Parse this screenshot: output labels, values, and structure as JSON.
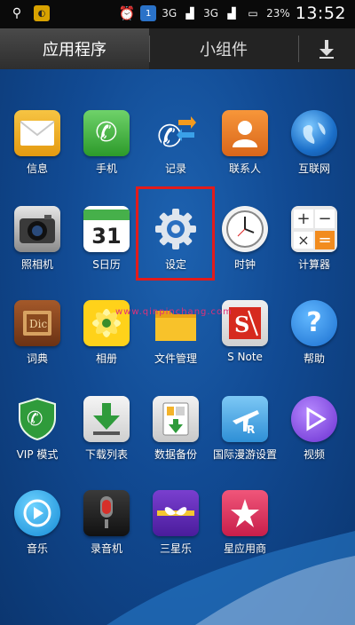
{
  "status_bar": {
    "time": "13:52",
    "battery": "23%",
    "network_1": "3G",
    "network_2": "3G",
    "sim": "1"
  },
  "tabs": {
    "apps": "应用程序",
    "widgets": "小组件"
  },
  "apps": [
    {
      "label": "信息",
      "icon": "envelope-icon"
    },
    {
      "label": "手机",
      "icon": "phone-icon"
    },
    {
      "label": "记录",
      "icon": "call-log-icon"
    },
    {
      "label": "联系人",
      "icon": "contacts-icon"
    },
    {
      "label": "互联网",
      "icon": "globe-icon"
    },
    {
      "label": "照相机",
      "icon": "camera-icon"
    },
    {
      "label": "S日历",
      "icon": "calendar-icon",
      "day": "31"
    },
    {
      "label": "设定",
      "icon": "gear-icon"
    },
    {
      "label": "时钟",
      "icon": "clock-icon"
    },
    {
      "label": "计算器",
      "icon": "calculator-icon"
    },
    {
      "label": "词典",
      "icon": "dictionary-icon"
    },
    {
      "label": "相册",
      "icon": "gallery-icon"
    },
    {
      "label": "文件管理",
      "icon": "folder-icon"
    },
    {
      "label": "S Note",
      "icon": "snote-icon"
    },
    {
      "label": "帮助",
      "icon": "help-icon"
    },
    {
      "label": "VIP 模式",
      "icon": "vip-shield-icon"
    },
    {
      "label": "下载列表",
      "icon": "download-list-icon"
    },
    {
      "label": "数据备份",
      "icon": "backup-icon"
    },
    {
      "label": "国际漫游设置",
      "icon": "roaming-icon"
    },
    {
      "label": "视频",
      "icon": "video-icon"
    },
    {
      "label": "音乐",
      "icon": "music-icon"
    },
    {
      "label": "录音机",
      "icon": "recorder-icon"
    },
    {
      "label": "三星乐",
      "icon": "samsung-hub-icon"
    },
    {
      "label": "星应用商",
      "icon": "app-store-icon"
    }
  ],
  "watermark": "www.qinpinchang.com"
}
